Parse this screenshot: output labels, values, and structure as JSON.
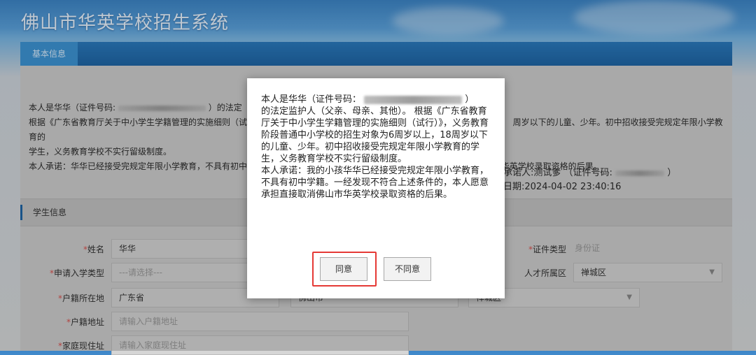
{
  "app": {
    "title": "佛山市华英学校招生系统"
  },
  "tabs": [
    {
      "label": "基本信息"
    }
  ],
  "notice": {
    "line1_prefix": "本人是华华（证件号码:",
    "line1_suffix": "）的法定",
    "line2_start": "根据《广东省教育厅关于中小学生学籍管理的实施细则（试",
    "line2_end": "周岁以下的儿童、少年。初中招收接受完规定年限小学教育的",
    "line3": "学生，义务教育学校不实行留级制度。",
    "line4_start": "本人承诺：华华已经接受完规定年限小学教育，不具有初中",
    "line4_end": "华英学校录取资格的后果。",
    "promiser": "承诺人:测试爹 （证件号码:",
    "promiser_end": "）",
    "date": "日期:2024-04-02 23:40:16"
  },
  "section": {
    "title": "学生信息"
  },
  "form": {
    "name_label": "姓名",
    "name_value": "华华",
    "cert_type_label": "证件类型",
    "cert_type_value": "身份证",
    "enroll_type_label": "申请入学类型",
    "enroll_type_placeholder": "---请选择---",
    "talent_area_label": "人才所属区",
    "talent_area_value": "禅城区",
    "hukou_label": "户籍所在地",
    "hukou_province": "广东省",
    "hukou_city": "佛山市",
    "hukou_district": "禅城区",
    "hukou_addr_label": "户籍地址",
    "hukou_addr_placeholder": "请输入户籍地址",
    "home_addr_label": "家庭现住址",
    "home_addr_placeholder": "请输入家庭现住址"
  },
  "modal": {
    "p1_prefix": "本人是华华（证件号码：",
    "p1_suffix": "）",
    "p2": "的法定监护人（父亲、母亲、其他）。 根据《广东省教育厅关于中小学生学籍管理的实施细则（试行）》，义务教育阶段普通中小学校的招生对象为6周岁以上，18周岁以下的儿童、少年。初中招收接受完规定年限小学教育的学生，义务教育学校不实行留级制度。",
    "p3": "本人承诺：我的小孩华华已经接受完规定年限小学教育，不具有初中学籍。一经发现不符合上述条件的，本人愿意承担直接取消佛山市华英学校录取资格的后果。",
    "agree_label": "同意",
    "disagree_label": "不同意"
  },
  "colors": {
    "header": "#1f66a6",
    "required": "#d9534f",
    "highlight": "#e53935"
  }
}
